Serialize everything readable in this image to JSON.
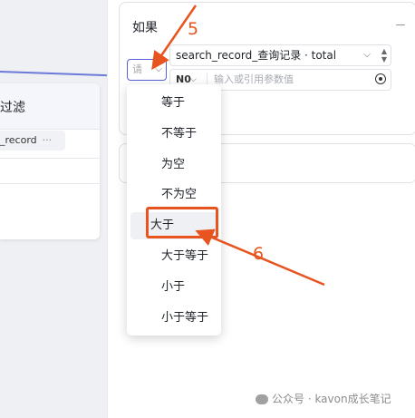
{
  "left_node": {
    "title": "过滤",
    "chip_label": "_record",
    "chip_more": "···"
  },
  "condition": {
    "title": "如果",
    "operator_placeholder": "请",
    "variable_label": "search_record_查询记录 · total",
    "value_type": "N0",
    "value_placeholder": "输入或引用参数值"
  },
  "operator_menu": {
    "items": [
      "等于",
      "不等于",
      "为空",
      "不为空",
      "大于",
      "大于等于",
      "小于",
      "小于等于"
    ],
    "hovered_index": 4
  },
  "annotations": {
    "step_5": "5",
    "step_6": "6",
    "color": "#e8541f"
  },
  "watermark": "公众号 · kavon成长笔记",
  "icons": {
    "chevron": "chevron-down-icon",
    "spinner": "up-down-spinner-icon",
    "target": "variable-reference-icon",
    "watermark": "wechat-icon"
  }
}
